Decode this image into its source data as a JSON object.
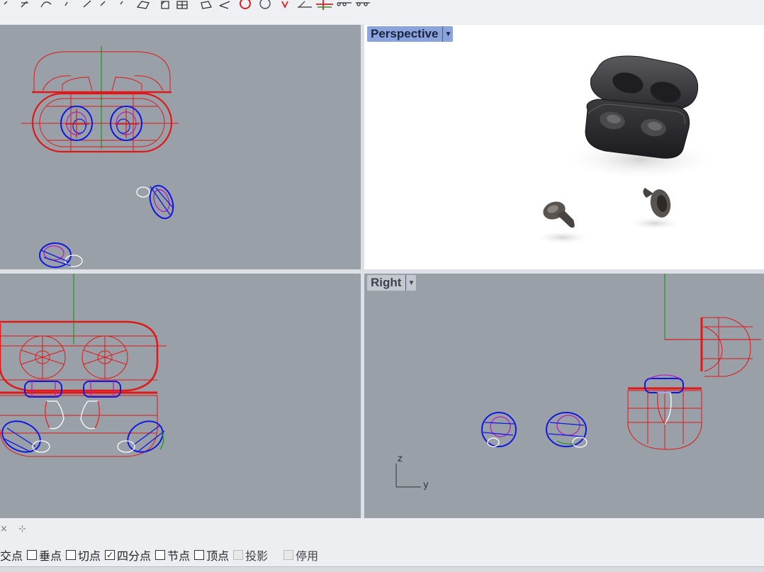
{
  "viewports": {
    "perspective": {
      "label": "Perspective",
      "dropdown_icon": "triangle-down-icon"
    },
    "right": {
      "label": "Right",
      "dropdown_icon": "triangle-down-icon"
    }
  },
  "axis_widget": {
    "z": "z",
    "y": "y"
  },
  "command": {
    "cross_icon": "×",
    "plus_icon": "⊹"
  },
  "osnap": [
    {
      "label": "交点",
      "checked": false,
      "enabled": true
    },
    {
      "label": "垂点",
      "checked": false,
      "enabled": true
    },
    {
      "label": "切点",
      "checked": false,
      "enabled": true
    },
    {
      "label": "四分点",
      "checked": true,
      "enabled": true
    },
    {
      "label": "节点",
      "checked": false,
      "enabled": true
    },
    {
      "label": "顶点",
      "checked": false,
      "enabled": true
    },
    {
      "label": "投影",
      "checked": false,
      "enabled": false
    },
    {
      "label": "停用",
      "checked": false,
      "enabled": false
    }
  ],
  "colors": {
    "viewport_bg": "#9aa0a8",
    "active_tab": "#8ca4dd",
    "wire_red": "#e01818",
    "wire_blue": "#1018e0"
  }
}
